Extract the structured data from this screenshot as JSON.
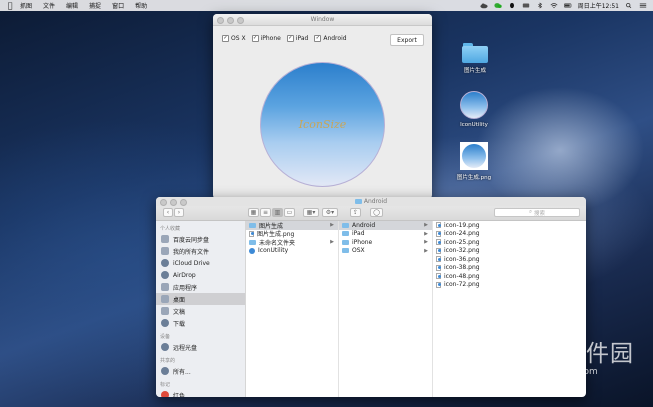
{
  "menubar": {
    "items": [
      "抓图",
      "文件",
      "编辑",
      "捕捉",
      "窗口",
      "帮助"
    ],
    "clock": "周日上午12:51"
  },
  "window": {
    "title": "Window",
    "platforms": [
      {
        "label": "OS X",
        "checked": true
      },
      {
        "label": "iPhone",
        "checked": true
      },
      {
        "label": "iPad",
        "checked": true
      },
      {
        "label": "Android",
        "checked": true
      }
    ],
    "export_label": "Export",
    "preview_text": "IconSize"
  },
  "desktop_icons": [
    {
      "label": "图片生成",
      "icon": "folder-icon"
    },
    {
      "label": "IconUtility",
      "icon": "app-icon"
    },
    {
      "label": "图片生成.png",
      "icon": "png-file-icon"
    }
  ],
  "finder": {
    "title": "Android",
    "search_placeholder": "搜索",
    "sidebar": {
      "favorites_header": "个人收藏",
      "favorites": [
        {
          "label": "百度云同步盘",
          "icon": "cloud-folder-icon",
          "selected": false
        },
        {
          "label": "我的所有文件",
          "icon": "all-files-icon",
          "selected": false
        },
        {
          "label": "iCloud Drive",
          "icon": "icloud-icon",
          "selected": false
        },
        {
          "label": "AirDrop",
          "icon": "airdrop-icon",
          "selected": false
        },
        {
          "label": "应用程序",
          "icon": "applications-icon",
          "selected": false
        },
        {
          "label": "桌面",
          "icon": "desktop-icon",
          "selected": true
        },
        {
          "label": "文稿",
          "icon": "documents-icon",
          "selected": false
        },
        {
          "label": "下载",
          "icon": "downloads-icon",
          "selected": false
        }
      ],
      "devices_header": "设备",
      "devices": [
        {
          "label": "远程光盘",
          "icon": "disc-icon"
        }
      ],
      "shared_header": "共享的",
      "shared": [
        {
          "label": "所有...",
          "icon": "network-icon"
        }
      ],
      "tags_header": "标记",
      "tags": [
        {
          "label": "红色",
          "icon": "red-tag-icon"
        }
      ]
    },
    "col1": [
      {
        "label": "图片生成",
        "type": "folder",
        "selected": true,
        "arrow": true
      },
      {
        "label": "图片生成.png",
        "type": "png",
        "selected": false,
        "arrow": false
      },
      {
        "label": "未命名文件夹",
        "type": "folder",
        "selected": false,
        "arrow": true
      },
      {
        "label": "IconUtility",
        "type": "app",
        "selected": false,
        "arrow": false
      }
    ],
    "col2": [
      {
        "label": "Android",
        "selected": true
      },
      {
        "label": "iPad",
        "selected": false
      },
      {
        "label": "iPhone",
        "selected": false
      },
      {
        "label": "OSX",
        "selected": false
      }
    ],
    "col3": [
      "icon-19.png",
      "icon-24.png",
      "icon-25.png",
      "icon-32.png",
      "icon-36.png",
      "icon-38.png",
      "icon-48.png",
      "icon-72.png"
    ]
  },
  "watermark": {
    "text": "当下软件园",
    "url": "www.downxia.com"
  }
}
